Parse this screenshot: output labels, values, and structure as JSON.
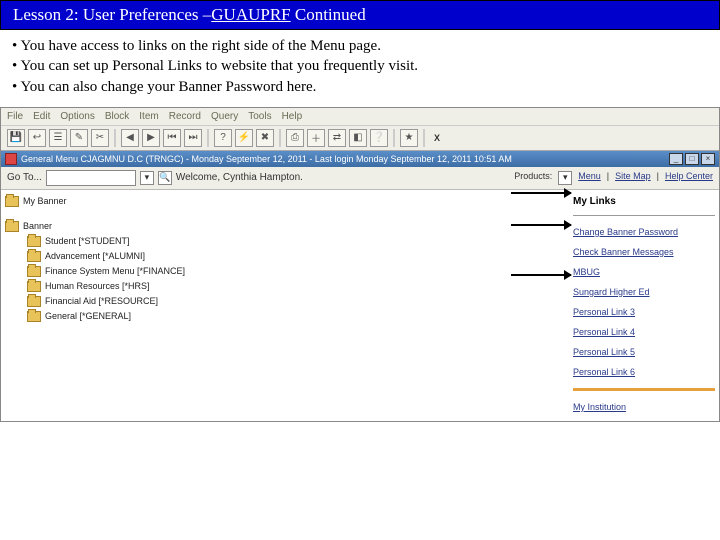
{
  "title_prefix": "Lesson 2: User Preferences –",
  "title_suffix": " Continued",
  "title_code": "GUAUPRF",
  "bullets": [
    "You have access to links on the right side of the Menu page.",
    "You can set up Personal Links to website that you frequently visit.",
    "You can also change your Banner Password here."
  ],
  "menubar": [
    "File",
    "Edit",
    "Options",
    "Block",
    "Item",
    "Record",
    "Query",
    "Tools",
    "Help"
  ],
  "window_title": "General Menu  CJAGMNU  D.C  (TRNGC)  -  Monday September 12, 2011 - Last login  Monday September 12, 2011 10:51 AM",
  "goto_label": "Go To...",
  "welcome": "Welcome, Cynthia Hampton.",
  "products_label": "Products:",
  "top_links": [
    "Menu",
    "Site Map",
    "Help Center"
  ],
  "tree": {
    "root1": "My Banner",
    "root2": "Banner",
    "children": [
      "Student [*STUDENT]",
      "Advancement [*ALUMNI]",
      "Finance System Menu [*FINANCE]",
      "Human Resources [*HRS]",
      "Financial Aid [*RESOURCE]",
      "General [*GENERAL]"
    ]
  },
  "sidebar": {
    "header": "My Links",
    "links": [
      "Change Banner Password",
      "Check Banner Messages",
      "MBUG",
      "Sungard Higher Ed",
      "Personal Link 3",
      "Personal Link 4",
      "Personal Link 5",
      "Personal Link 6"
    ],
    "footer": "My Institution"
  }
}
